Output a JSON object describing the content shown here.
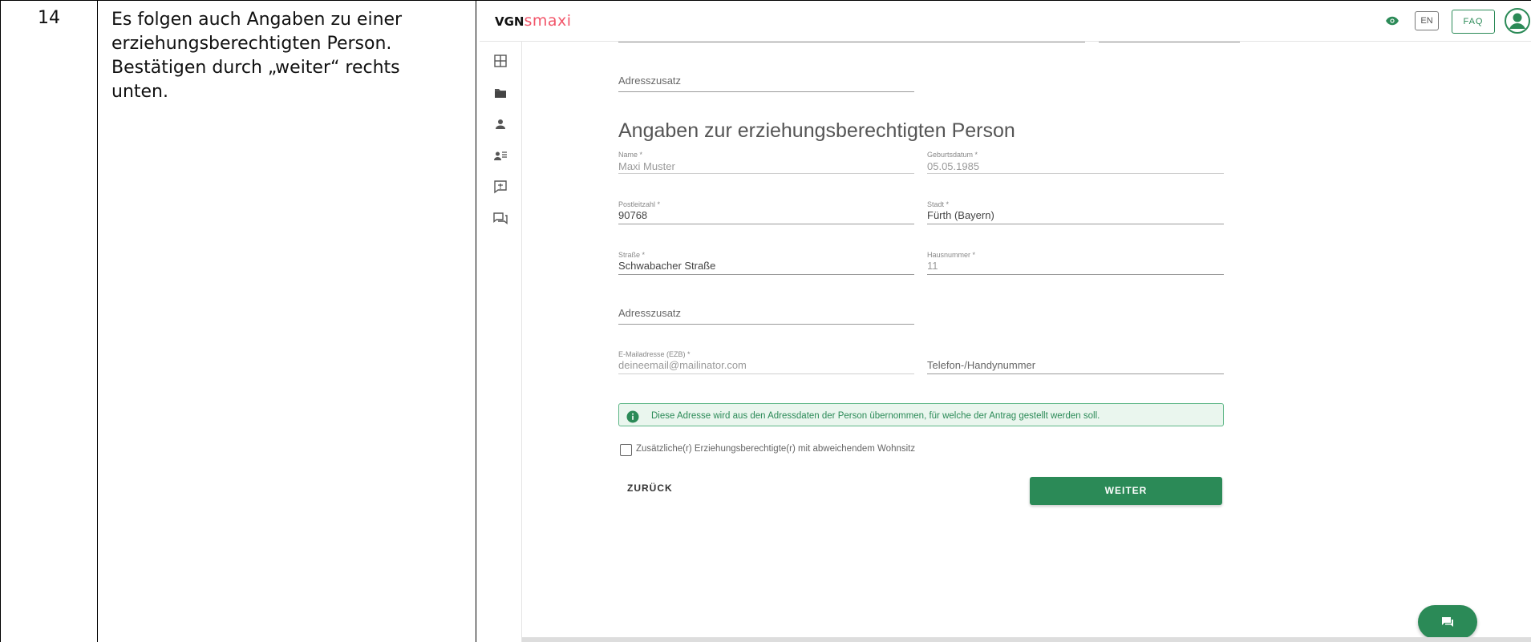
{
  "doc": {
    "step_number": "14",
    "instruction_line1": "Es folgen auch Angaben zu einer",
    "instruction_line2": "erziehungsberechtigten Person.",
    "instruction_line3": "Bestätigen durch „weiter“ rechts",
    "instruction_line4": "unten."
  },
  "header": {
    "logo_vgn": "VGN",
    "logo_smaxi": "smaxi",
    "eye_icon": "eye-icon",
    "lang_label": "EN",
    "faq_label": "FAQ",
    "avatar_icon": "account-circle-icon",
    "accent_color": "#2b8a57",
    "brand_color": "#f2566a"
  },
  "sidebar": {
    "items": [
      {
        "icon": "grid-icon"
      },
      {
        "icon": "folder-icon"
      },
      {
        "icon": "person-icon"
      },
      {
        "icon": "person-list-icon"
      },
      {
        "icon": "feedback-icon"
      },
      {
        "icon": "chat-icon"
      }
    ]
  },
  "form": {
    "address_extra_top": {
      "placeholder": "Adresszusatz"
    },
    "section_title": "Angaben zur erziehungsberechtigten Person",
    "name": {
      "label": "Name *",
      "value": "Maxi Muster"
    },
    "birthdate": {
      "label": "Geburtsdatum *",
      "value": "05.05.1985"
    },
    "postal_code": {
      "label": "Postleitzahl *",
      "value": "90768"
    },
    "city": {
      "label": "Stadt *",
      "value": "Fürth (Bayern)"
    },
    "street": {
      "label": "Straße *",
      "value": "Schwabacher Straße"
    },
    "house_number": {
      "label": "Hausnummer *",
      "value": "11"
    },
    "address_extra": {
      "placeholder": "Adresszusatz"
    },
    "email": {
      "label": "E-Mailadresse (EZB) *",
      "value": "deineemail@mailinator.com"
    },
    "phone": {
      "placeholder": "Telefon-/Handynummer"
    },
    "info_text": "Diese Adresse wird aus den Adressdaten der Person übernommen, für welche der Antrag gestellt werden soll.",
    "checkbox_label": "Zusätzliche(r) Erziehungsberechtigte(r) mit abweichendem Wohnsitz",
    "back_label": "ZURÜCK",
    "next_label": "WEITER"
  }
}
